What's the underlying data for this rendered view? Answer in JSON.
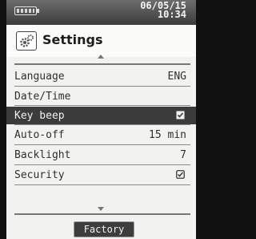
{
  "status": {
    "date": "06/05/15",
    "time": "10:34"
  },
  "header": {
    "title": "Settings"
  },
  "menu": [
    {
      "label": "Language",
      "value": "ENG"
    },
    {
      "label": "Date/Time",
      "value": ""
    },
    {
      "label": "Key beep",
      "value": "checked",
      "selected": true
    },
    {
      "label": "Auto-off",
      "value": "15 min"
    },
    {
      "label": "Backlight",
      "value": "7"
    },
    {
      "label": "Security",
      "value": "checked"
    }
  ],
  "footer": {
    "button_label": "Factory"
  }
}
